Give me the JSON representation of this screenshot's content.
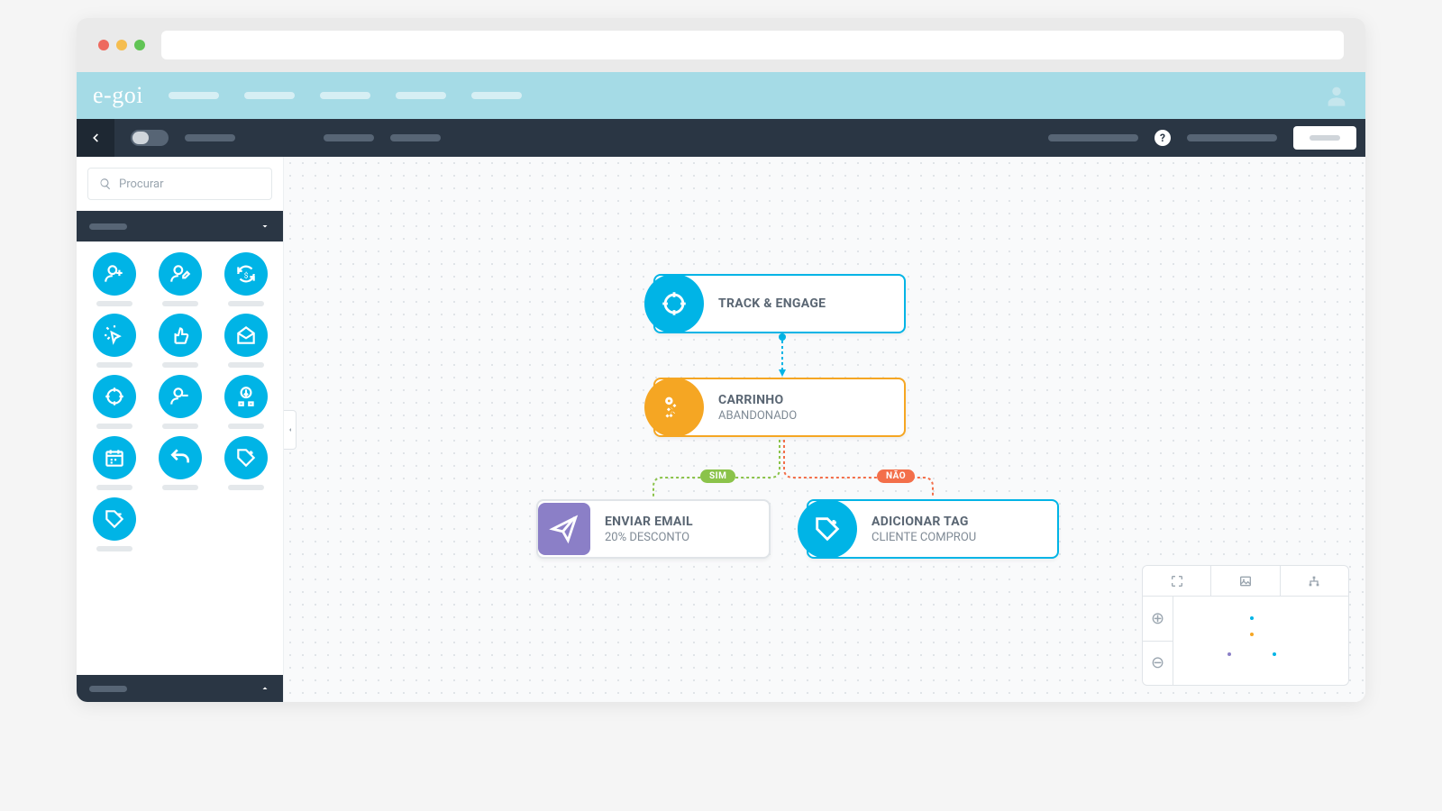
{
  "logo": "e-goi",
  "search": {
    "placeholder": "Procurar"
  },
  "nodes": {
    "track": {
      "title": "TRACK & ENGAGE"
    },
    "cart": {
      "title": "CARRINHO",
      "sub": "ABANDONADO"
    },
    "email": {
      "title": "ENVIAR EMAIL",
      "sub": "20% DESCONTO"
    },
    "tag": {
      "title": "ADICIONAR TAG",
      "sub": "CLIENTE COMPROU"
    }
  },
  "branch": {
    "yes": "SIM",
    "no": "NÃO"
  },
  "colors": {
    "blue": "#00b4e6",
    "orange": "#f5a623",
    "purple": "#8b7fc7",
    "green": "#8bc34a",
    "red": "#f36f4a"
  }
}
